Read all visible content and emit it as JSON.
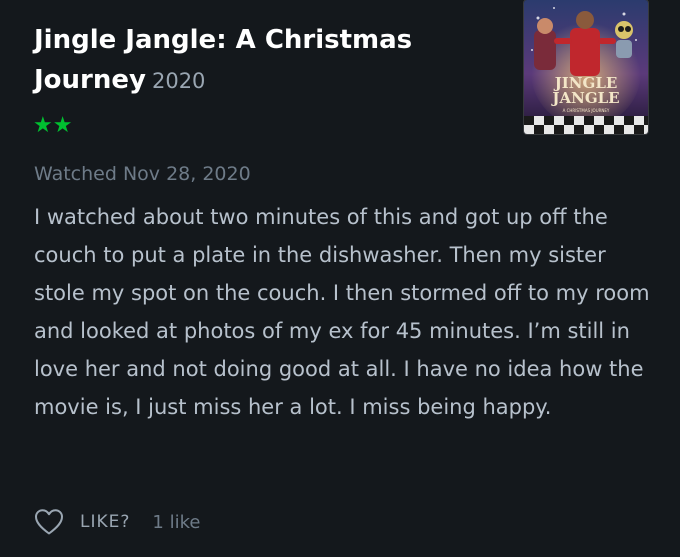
{
  "film": {
    "title": "Jingle Jangle: A Christmas Journey",
    "year": "2020",
    "rating_stars": "★★",
    "poster": {
      "text_line1": "JINGLE",
      "text_line2": "JANGLE",
      "subtitle": "A CHRISTMAS JOURNEY"
    }
  },
  "review": {
    "watched_label": "Watched Nov 28, 2020",
    "body": "I watched about two minutes of this and got up off the couch to put a plate in the dishwasher. Then my sister stole my spot on the couch. I then stormed off to my room and looked at photos of my ex for 45 minutes. I’m still in love her and not doing good at all. I have no idea how the movie is, I just miss her a lot. I miss being happy."
  },
  "actions": {
    "like_label": "LIKE?",
    "like_count": "1 like"
  },
  "colors": {
    "background": "#14181c",
    "star_green": "#00c030",
    "title": "#ffffff",
    "muted": "#6e7b88",
    "body_text": "#b7c1cc"
  },
  "icons": {
    "like": "heart-outline-icon"
  }
}
